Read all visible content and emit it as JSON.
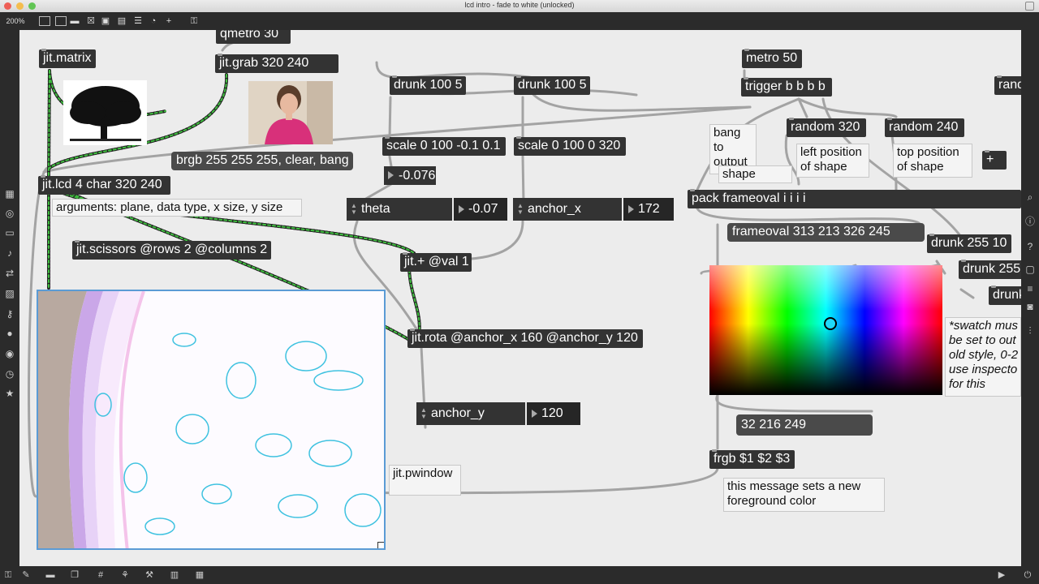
{
  "window": {
    "title": "lcd intro - fade to white (unlocked)",
    "zoom": "200%"
  },
  "objects": {
    "qmetro": "qmetro 30",
    "jit_matrix": "jit.matrix",
    "jit_grab": "jit.grab 320 240",
    "drunk1": "drunk 100 5",
    "drunk2": "drunk 100 5",
    "metro": "metro 50",
    "trigger": "trigger b b b b",
    "random320": "random 320",
    "random240": "random 240",
    "rand_partial": "rand",
    "scale1": "scale 0 100 -0.1 0.1",
    "scale2": "scale 0 100 0 320",
    "plus": "+",
    "jit_lcd": "jit.lcd 4 char 320 240",
    "jit_scissors": "jit.scissors @rows 2 @columns 2",
    "jit_plus": "jit.+ @val 1",
    "jit_rota": "jit.rota @anchor_x 160 @anchor_y 120",
    "pack": "pack frameoval i i i i",
    "drunk255a": "drunk 255 10",
    "drunk255b": "drunk 255",
    "drunk255c": "drunk",
    "frgb": "frgb $1 $2 $3"
  },
  "messages": {
    "brgb": "brgb 255 255 255, clear, bang",
    "frameoval": "frameoval 313 213 326 245",
    "swatch_value": "32 216 249"
  },
  "numbers": {
    "scale_out": "-0.076"
  },
  "attrs": {
    "theta": {
      "name": "theta",
      "value": "-0.07"
    },
    "anchor_x": {
      "name": "anchor_x",
      "value": "172"
    },
    "anchor_y": {
      "name": "anchor_y",
      "value": "120"
    }
  },
  "comments": {
    "args": "arguments: plane, data type, x size, y size",
    "bang_output": "bang\nto\noutput",
    "shape": "shape",
    "left_pos": "left position\nof shape",
    "top_pos": "top position\nof shape",
    "pwindow": "jit.pwindow",
    "fg_color": "this message sets a new\nforeground color",
    "swatch_note": "*swatch mus\nbe set to out\nold style, 0-2\nuse inspecto\nfor this"
  },
  "colors": {
    "canvas_bg": "#ececec",
    "object_bg": "#333333",
    "cable_green": "#3fbf3f",
    "selection_blue": "#5b9bd5"
  },
  "swatch": {
    "selected_rgb": [
      32,
      216,
      249
    ]
  },
  "icons": {
    "toolbar": [
      "new-object-icon",
      "presentation-icon",
      "comment-icon",
      "toggle-icon",
      "number-box-icon",
      "message-icon",
      "slider-icon",
      "dial-icon",
      "add-icon",
      "lock-icon"
    ],
    "left": [
      "grid-icon",
      "target-icon",
      "panel-icon",
      "note-icon",
      "transfer-icon",
      "image-icon",
      "key-icon",
      "stop-icon",
      "video-icon",
      "clock-icon",
      "star-icon"
    ],
    "right": [
      "search-icon",
      "info-icon",
      "hint-icon",
      "window-icon",
      "list-icon",
      "camera-icon",
      "settings-icon"
    ],
    "bottom": [
      "lock-icon",
      "edit-icon",
      "chat-icon",
      "windows-icon",
      "grid-icon",
      "patch-icon",
      "wrench-icon",
      "columns-icon",
      "table-icon",
      "play-icon",
      "power-icon"
    ]
  }
}
